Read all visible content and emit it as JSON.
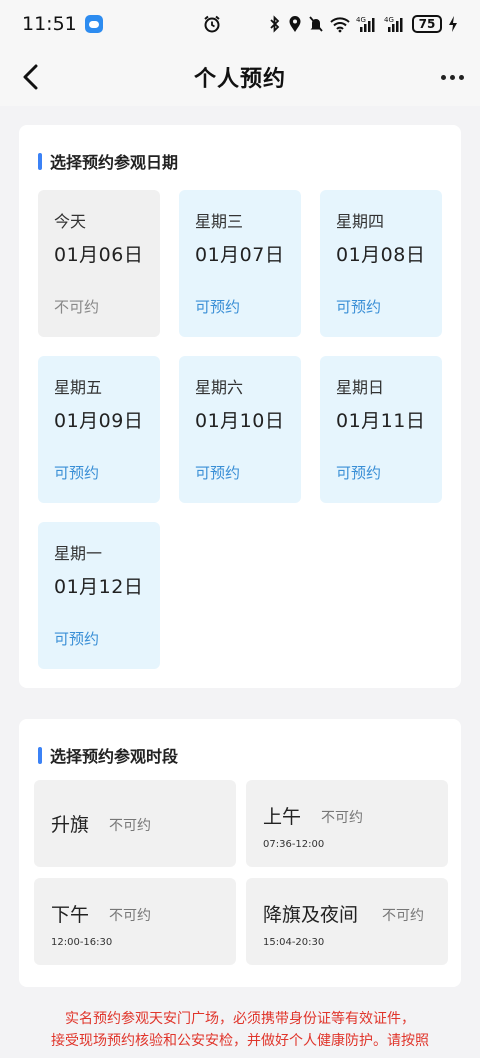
{
  "status_bar": {
    "time": "11:51",
    "battery": "75",
    "icons": [
      "message-app-icon",
      "alarm-icon",
      "bluetooth-icon",
      "location-icon",
      "mute-icon",
      "wifi-icon",
      "signal-4g-icon",
      "signal-4g-icon",
      "battery-icon",
      "charging-icon"
    ]
  },
  "header": {
    "title": "个人预约",
    "back_icon": "chevron-left-icon",
    "more_icon": "more-horizontal-icon"
  },
  "date_section": {
    "title": "选择预约参观日期",
    "dates": [
      {
        "weekday": "今天",
        "day": "01月06日",
        "status": "不可约",
        "available": false
      },
      {
        "weekday": "星期三",
        "day": "01月07日",
        "status": "可预约",
        "available": true
      },
      {
        "weekday": "星期四",
        "day": "01月08日",
        "status": "可预约",
        "available": true
      },
      {
        "weekday": "星期五",
        "day": "01月09日",
        "status": "可预约",
        "available": true
      },
      {
        "weekday": "星期六",
        "day": "01月10日",
        "status": "可预约",
        "available": true
      },
      {
        "weekday": "星期日",
        "day": "01月11日",
        "status": "可预约",
        "available": true
      },
      {
        "weekday": "星期一",
        "day": "01月12日",
        "status": "可预约",
        "available": true
      }
    ]
  },
  "time_section": {
    "title": "选择预约参观时段",
    "slots": [
      {
        "name": "升旗",
        "status": "不可约",
        "range": ""
      },
      {
        "name": "上午",
        "status": "不可约",
        "range": "07:36-12:00"
      },
      {
        "name": "下午",
        "status": "不可约",
        "range": "12:00-16:30"
      },
      {
        "name": "降旗及夜间",
        "status": "不可约",
        "range": "15:04-20:30"
      }
    ]
  },
  "notice": {
    "line1": "实名预约参观天安门广场，必须携带身份证等有效证件，",
    "line2": "接受现场预约核验和公安安检，并做好个人健康防护。请按照"
  },
  "colors": {
    "accent": "#3b82f6",
    "available_bg": "#e6f5fd",
    "available_text": "#3a8fd6",
    "unavailable_bg": "#f0f0f0",
    "notice_text": "#e0352b"
  }
}
